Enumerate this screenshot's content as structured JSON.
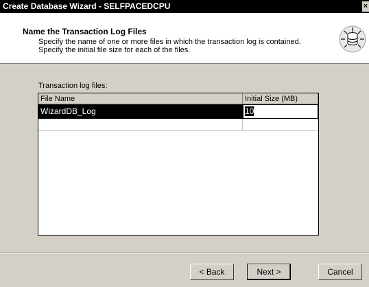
{
  "window": {
    "title": "Create Database Wizard - SELFPACEDCPU",
    "close_glyph": "×"
  },
  "header": {
    "title": "Name the Transaction Log Files",
    "line1": "Specify the name of one or more files in which the transaction log is contained.",
    "line2": "Specify the initial file size for each of the files.",
    "icon": "database-wizard-icon"
  },
  "content": {
    "label": "Transaction log files:",
    "columns": [
      "File Name",
      "Initial Size (MB)"
    ],
    "rows": [
      {
        "file_name": "WizardDB_Log",
        "initial_size": "10"
      }
    ]
  },
  "buttons": {
    "back": "< Back",
    "next": "Next >",
    "cancel": "Cancel"
  },
  "colors": {
    "dialog_bg": "#d4d0c8",
    "title_bg": "#000000",
    "selection_bg": "#000000"
  }
}
